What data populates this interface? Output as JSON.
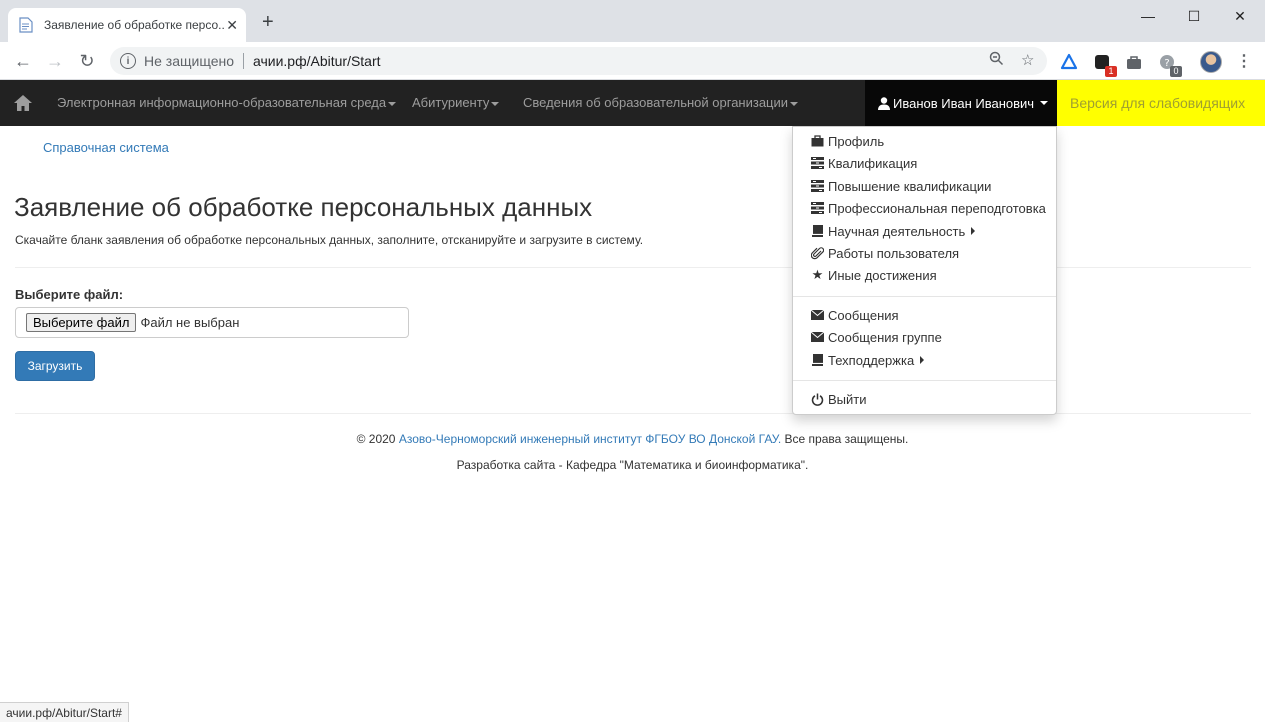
{
  "browser": {
    "tab_title": "Заявление об обработке персо...",
    "insecure_label": "Не защищено",
    "url": "ачии.рф/Abitur/Start",
    "ext_badges": [
      "1",
      "0"
    ],
    "status_url": "ачии.рф/Abitur/Start#"
  },
  "navbar": {
    "items": [
      {
        "label": "Электронная информационно-образовательная среда"
      },
      {
        "label": "Абитуриенту"
      },
      {
        "label": "Сведения об образовательной организации"
      }
    ],
    "user_name": "Иванов Иван Иванович",
    "visually_impaired": "Версия для слабовидящих"
  },
  "page": {
    "help_link": "Справочная система",
    "title": "Заявление об обработке персональных данных",
    "description": "Скачайте бланк заявления об обработке персональных данных, заполните, отсканируйте и загрузите в систему.",
    "file_label": "Выберите файл:",
    "file_button": "Выберите файл",
    "file_status": "Файл не выбран",
    "upload_button": "Загрузить"
  },
  "footer": {
    "copyright_prefix": "© 2020 ",
    "org_link": "Азово-Черноморский инженерный институт ФГБОУ ВО Донской ГАУ.",
    "rights": " Все права защищены.",
    "dev": "Разработка сайта - Кафедра \"Математика и биоинформатика\"."
  },
  "dropdown": {
    "items": [
      {
        "label": "Профиль",
        "icon": "briefcase-icon"
      },
      {
        "label": "Квалификация",
        "icon": "tasks-icon"
      },
      {
        "label": "Повышение квалификации",
        "icon": "tasks-icon"
      },
      {
        "label": "Профессиональная переподготовка",
        "icon": "tasks-icon"
      },
      {
        "label": "Научная деятельность",
        "icon": "book-icon"
      },
      {
        "label": "Работы пользователя",
        "icon": "paperclip-icon"
      },
      {
        "label": "Иные достижения",
        "icon": "star-icon"
      },
      {
        "label": "Сообщения",
        "icon": "envelope-icon"
      },
      {
        "label": "Сообщения группе",
        "icon": "envelope-icon"
      },
      {
        "label": "Техподдержка",
        "icon": "book-icon"
      },
      {
        "label": "Выйти",
        "icon": "power-icon"
      }
    ]
  },
  "colors": {
    "navbar_bg": "#222222",
    "accent_link": "#337ab7",
    "visually_impaired_bg": "#ffff00"
  }
}
